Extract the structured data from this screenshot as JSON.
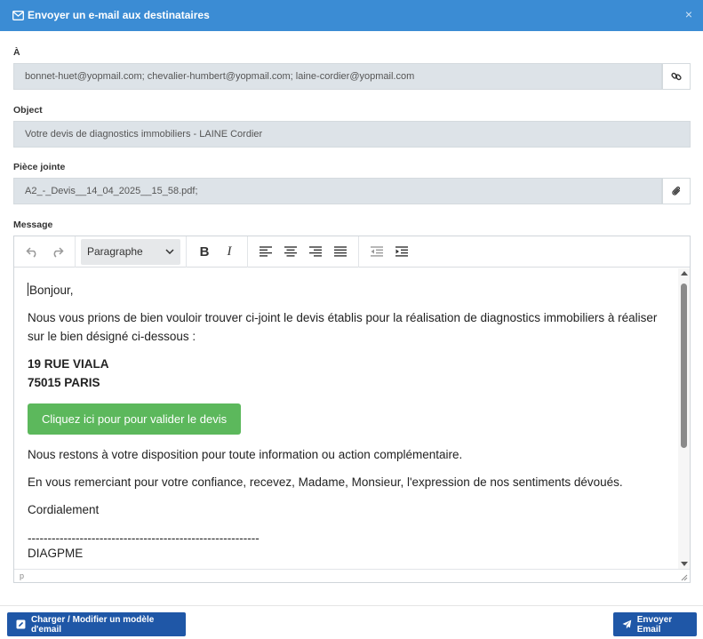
{
  "header": {
    "title": "Envoyer un e-mail aux destinataires",
    "close": "×"
  },
  "to": {
    "label": "À",
    "value": "bonnet-huet@yopmail.com; chevalier-humbert@yopmail.com; laine-cordier@yopmail.com"
  },
  "object": {
    "label": "Object",
    "value": "Votre devis de diagnostics immobiliers - LAINE Cordier"
  },
  "attachment": {
    "label": "Pièce jointe",
    "value": "A2_-_Devis__14_04_2025__15_58.pdf;"
  },
  "message": {
    "label": "Message",
    "toolbar": {
      "format_select": "Paragraphe",
      "bold": "B",
      "italic": "I"
    },
    "body": {
      "greeting": "Bonjour,",
      "intro": "Nous vous prions de bien vouloir trouver ci-joint le devis établis pour la réalisation de diagnostics immobiliers à réaliser sur le bien désigné ci-dessous :",
      "address_line1": "19 RUE VIALA",
      "address_line2": "75015 PARIS",
      "validate_button": "Cliquez ici pour pour valider le devis",
      "availability": "Nous restons à votre disposition pour toute information ou action complémentaire.",
      "thanks": "En vous remerciant pour votre confiance, recevez, Madame, Monsieur, l'expression de nos sentiments dévoués.",
      "closing": "Cordialement",
      "separator": "----------------------------------------------------------",
      "company": "DIAGPME"
    },
    "statusbar": "p"
  },
  "footer": {
    "template_button": "Charger / Modifier un modèle d'email",
    "send_button": "Envoyer Email"
  },
  "colors": {
    "header_bg": "#3b8cd4",
    "primary_button": "#1f57a7",
    "validate_button": "#5cb85c",
    "field_bg": "#dde3e8"
  }
}
